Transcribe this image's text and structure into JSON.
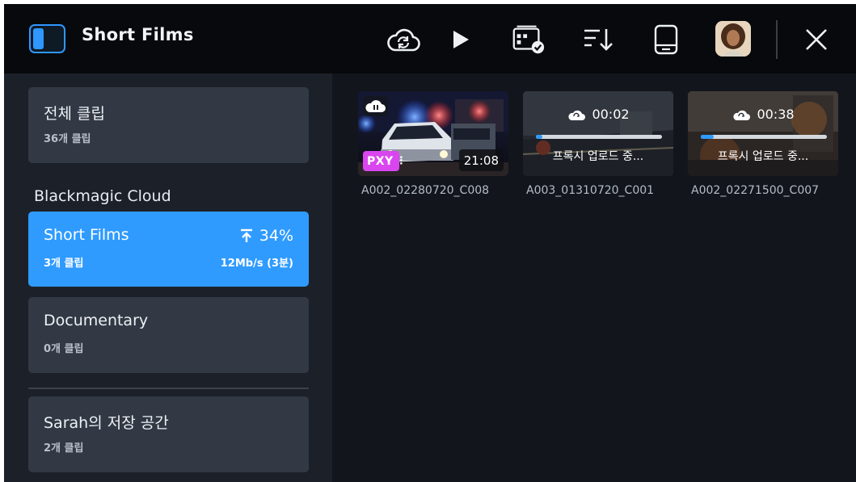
{
  "app": {
    "title": "Short Films"
  },
  "toolbar": {
    "icons": [
      "cloud-sync-icon",
      "play-icon",
      "media-card-check-icon",
      "sort-icon",
      "storage-drive-icon",
      "avatar",
      "close-icon"
    ]
  },
  "sidebar": {
    "all_clips": {
      "name": "전체 클립",
      "count": "36개 클립"
    },
    "section_heading": "Blackmagic Cloud",
    "projects": [
      {
        "name": "Short Films",
        "count": "3개 클립",
        "upload_percent": "34%",
        "upload_rate": "12Mb/s (3분)",
        "active": true
      },
      {
        "name": "Documentary",
        "count": "0개 클립",
        "active": false
      }
    ],
    "local_storage": {
      "name": "Sarah의 저장 공간",
      "count": "2개 클립"
    }
  },
  "clips": [
    {
      "name": "A002_02280720_C008",
      "duration": "21:08",
      "badge": "PXY",
      "paused": true
    },
    {
      "name": "A003_01310720_C001",
      "remaining": "00:02",
      "status": "프록시 업로드 중...",
      "progress": 0.05
    },
    {
      "name": "A002_02271500_C007",
      "remaining": "00:38",
      "status": "프록시 업로드 중...",
      "progress": 0.1
    }
  ],
  "colors": {
    "accent": "#2f9bff",
    "proxy_badge": "#d946ef",
    "topbar": "#07090c",
    "panel": "#1c2129"
  }
}
